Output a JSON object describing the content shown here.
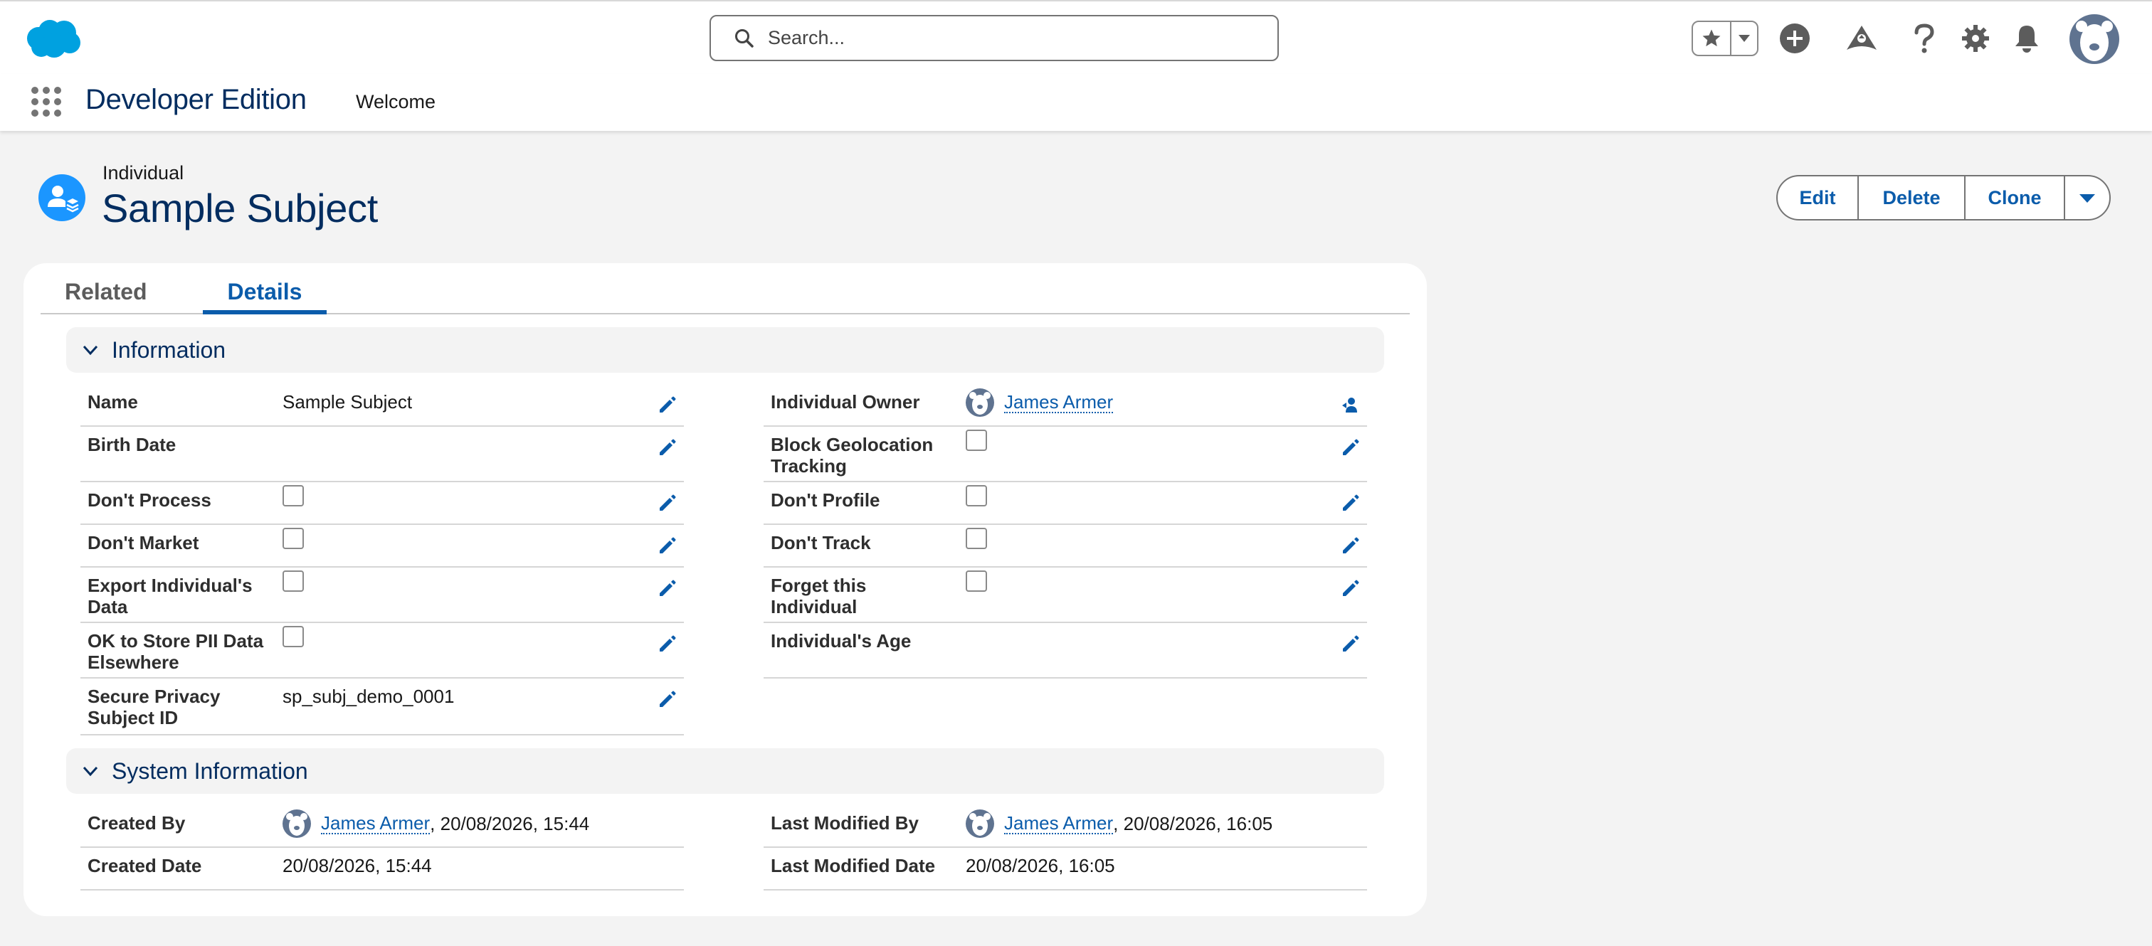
{
  "header": {
    "search_placeholder": "Search...",
    "brand_color": "#00a1e0"
  },
  "nav": {
    "app_name": "Developer Edition",
    "items": [
      "Welcome"
    ]
  },
  "record": {
    "type": "Individual",
    "title": "Sample Subject",
    "actions": {
      "edit": "Edit",
      "delete": "Delete",
      "clone": "Clone"
    }
  },
  "tabs": {
    "related": "Related",
    "details": "Details",
    "active": "Details"
  },
  "sections": {
    "information": {
      "title": "Information",
      "left": [
        {
          "label": "Name",
          "value": "Sample Subject"
        },
        {
          "label": "Birth Date",
          "value": ""
        },
        {
          "label": "Don't Process",
          "checkbox": false
        },
        {
          "label": "Don't Market",
          "checkbox": false
        },
        {
          "label": "Export Individual's Data",
          "checkbox": false
        },
        {
          "label": "OK to Store PII Data Elsewhere",
          "checkbox": false
        },
        {
          "label": "Secure Privacy Subject ID",
          "value": "sp_subj_demo_0001"
        }
      ],
      "right": [
        {
          "label": "Individual Owner",
          "value": "James Armer"
        },
        {
          "label": "Block Geolocation Tracking",
          "checkbox": false
        },
        {
          "label": "Don't Profile",
          "checkbox": false
        },
        {
          "label": "Don't Track",
          "checkbox": false
        },
        {
          "label": "Forget this Individual",
          "checkbox": false
        },
        {
          "label": "Individual's Age",
          "value": ""
        }
      ]
    },
    "system": {
      "title": "System Information",
      "created_by": {
        "label": "Created By",
        "user": "James Armer",
        "suffix": ", 20/08/2026, 15:44"
      },
      "created_date": {
        "label": "Created Date",
        "value": "20/08/2026, 15:44"
      },
      "last_modified_by": {
        "label": "Last Modified By",
        "user": "James Armer",
        "suffix": ", 20/08/2026, 16:05"
      },
      "last_modified_date": {
        "label": "Last Modified Date",
        "value": "20/08/2026, 16:05"
      }
    }
  }
}
